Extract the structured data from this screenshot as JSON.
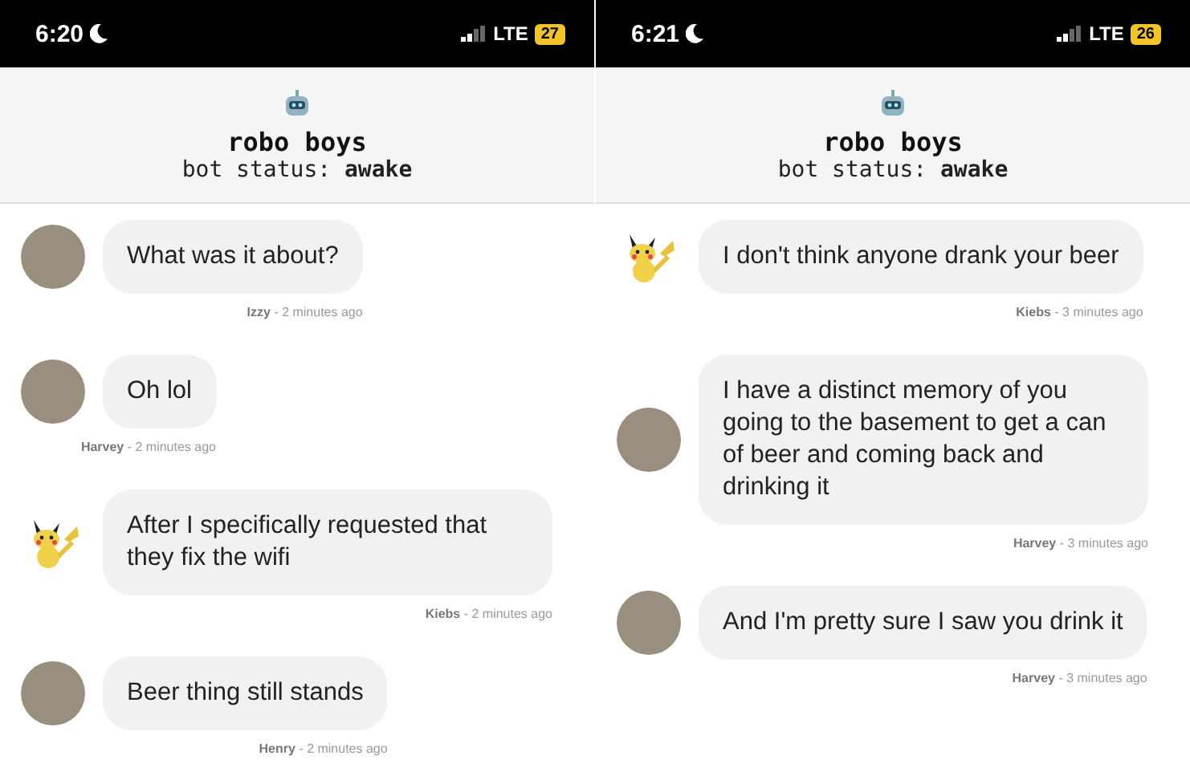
{
  "screens": [
    {
      "status_bar": {
        "time": "6:20",
        "network": "LTE",
        "battery": "27"
      },
      "header": {
        "title": "robo boys",
        "status": "bot status: **awake**"
      },
      "messages": [
        {
          "kind": "photo",
          "text": "What was it about?",
          "meta": "**Izzy** - 2 minutes ago"
        },
        {
          "kind": "photo",
          "text": "Oh lol",
          "meta": "**Harvey** - 2 minutes ago"
        },
        {
          "kind": "cartoon",
          "text": "After I specifically requested that they fix the wifi",
          "meta": "**Kiebs** - 2 minutes ago"
        },
        {
          "kind": "photo",
          "text": "Beer thing still stands",
          "meta": "**Henry** - 2 minutes ago"
        }
      ]
    },
    {
      "status_bar": {
        "time": "6:21",
        "network": "LTE",
        "battery": "26"
      },
      "header": {
        "title": "robo boys",
        "status": "bot status: **awake**"
      },
      "messages": [
        {
          "kind": "cartoon",
          "text": "I don't think anyone drank your beer",
          "meta": "**Kiebs** - 3 minutes ago"
        },
        {
          "kind": "photo",
          "text": "I have a distinct memory of you going to the basement to get a can of beer and coming back and drinking it",
          "meta": "**Harvey** - 3 minutes ago"
        },
        {
          "kind": "photo",
          "text": "And I'm pretty sure I saw you drink it",
          "meta": "**Harvey** - 3 minutes ago"
        }
      ]
    }
  ]
}
